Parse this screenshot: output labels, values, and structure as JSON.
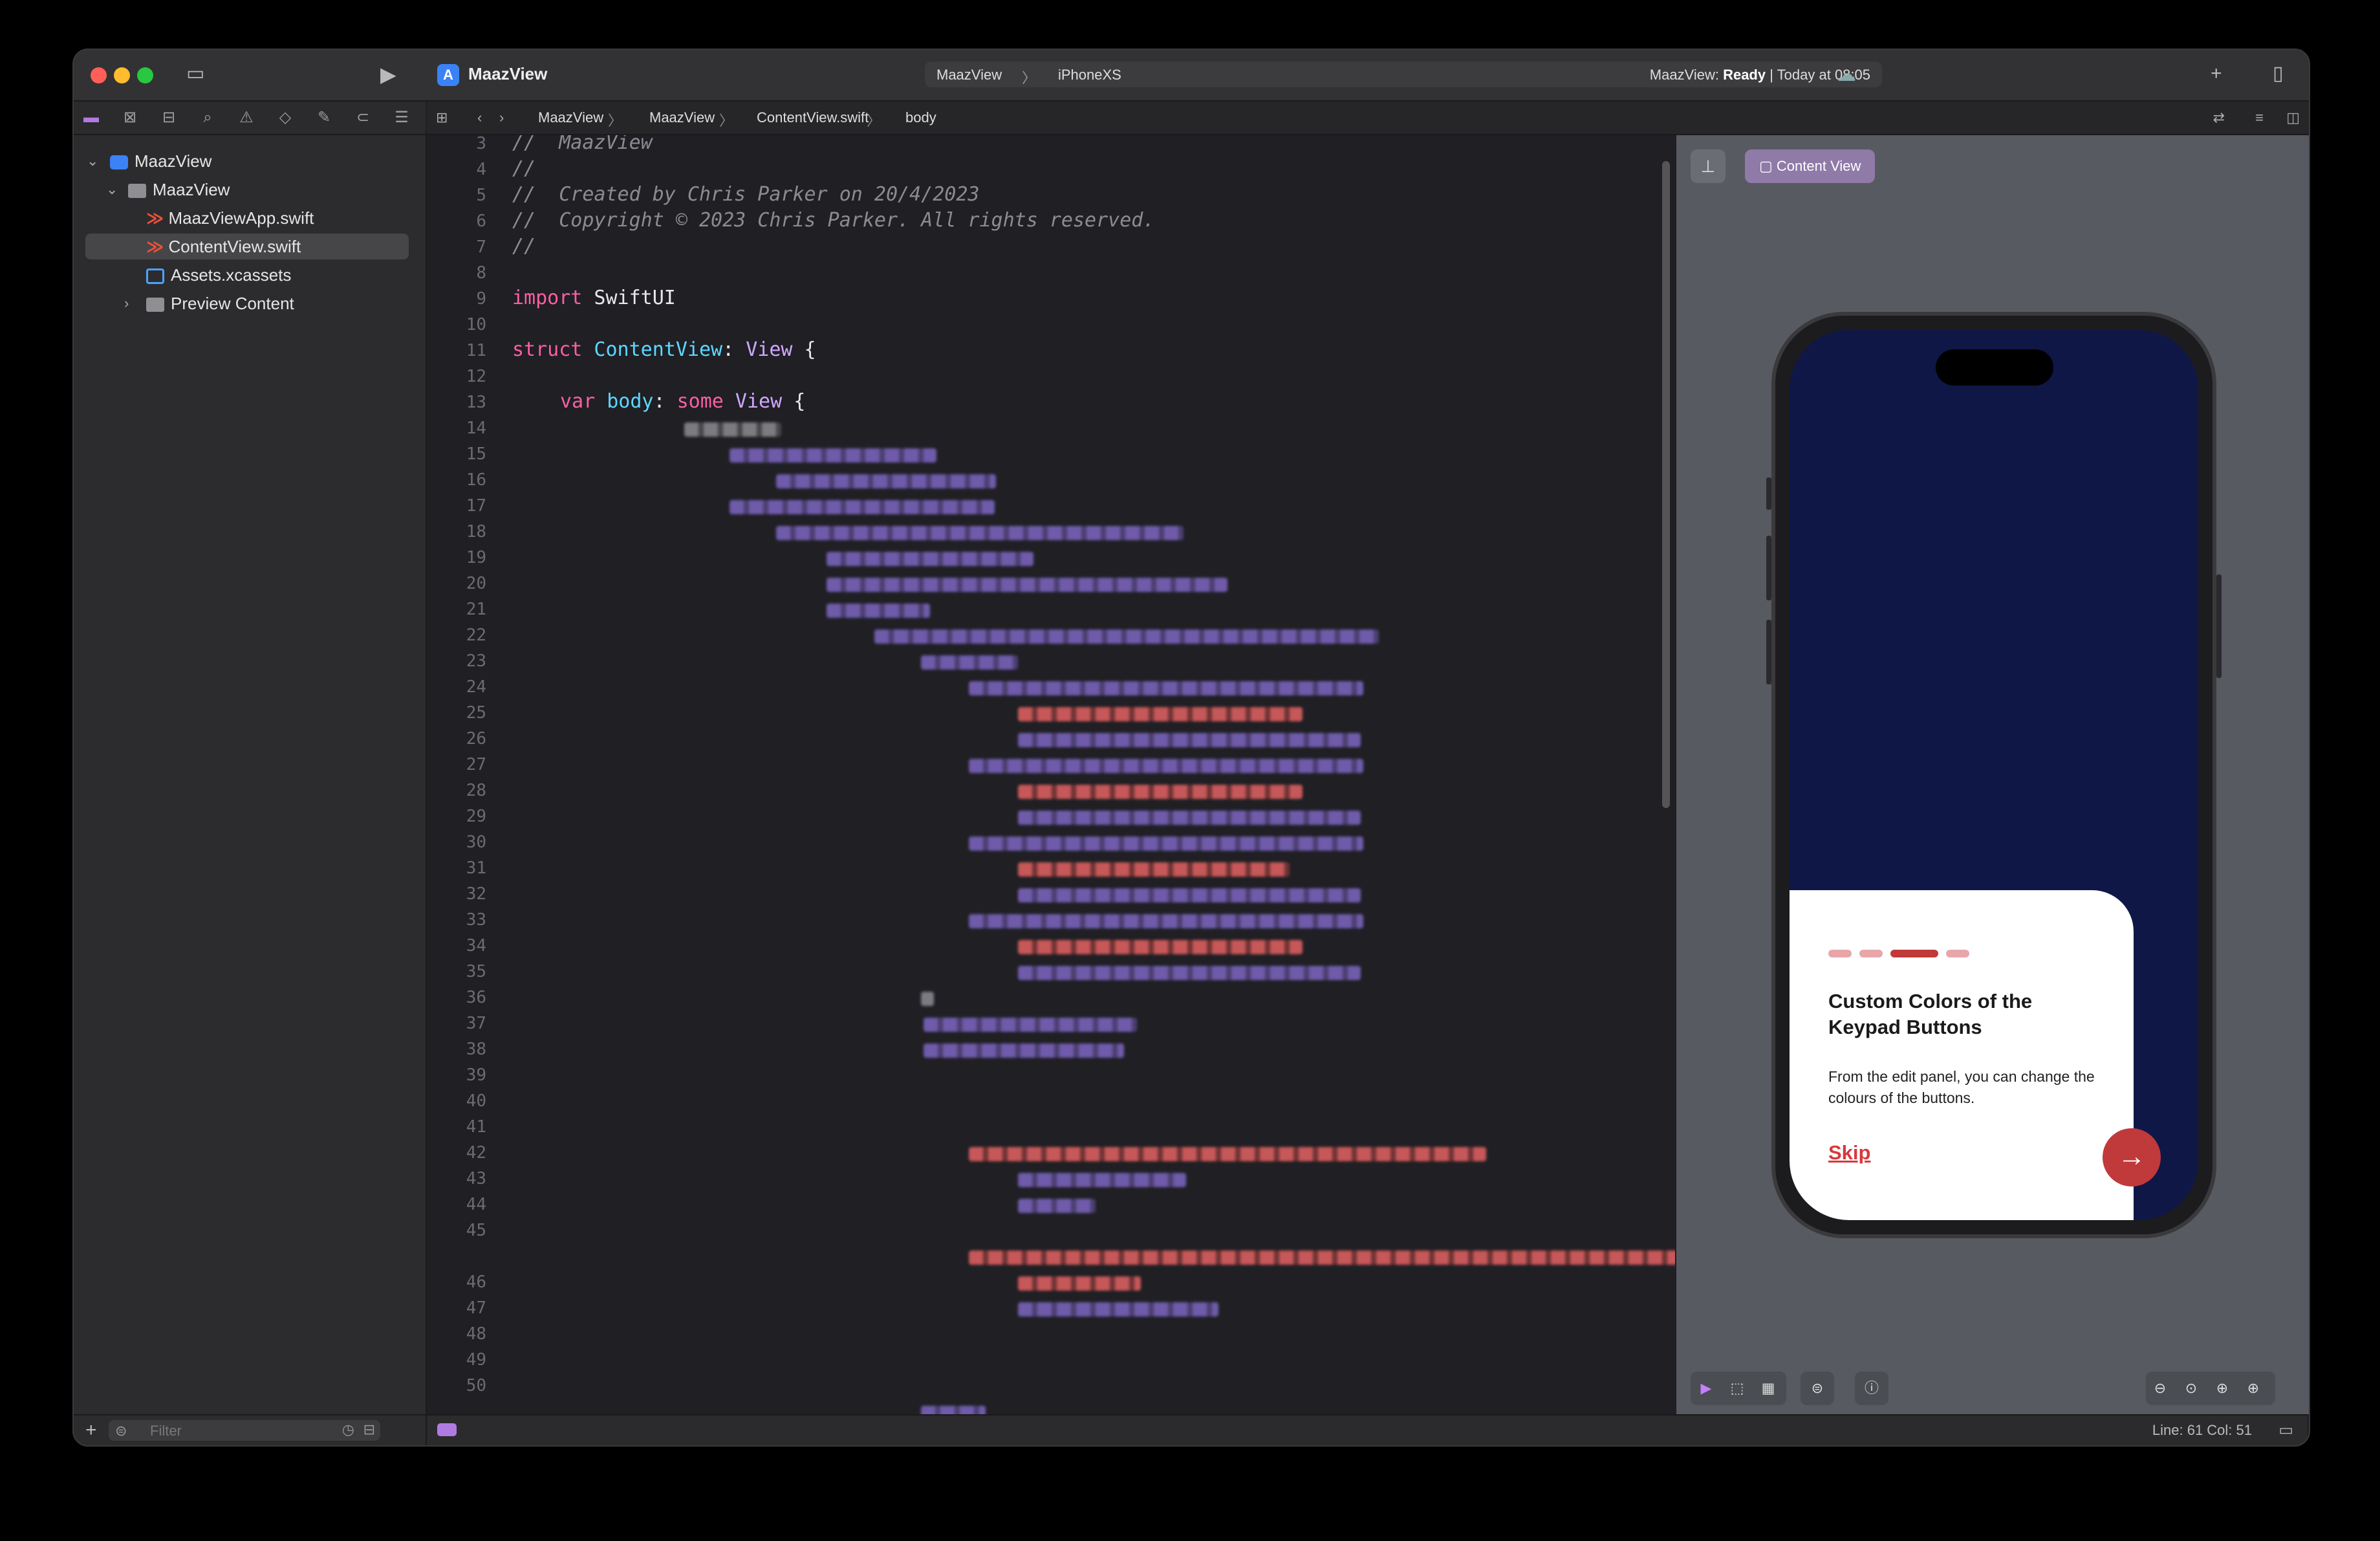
{
  "window": {
    "project_title": "MaazView",
    "scheme": {
      "target": "MaazView",
      "device": "iPhoneXS"
    },
    "status": {
      "prefix": "MaazView: ",
      "state": "Ready",
      "suffix": " | Today at 08:05"
    }
  },
  "jumpbar": {
    "items": [
      "MaazView",
      "MaazView",
      "ContentView.swift",
      "body"
    ]
  },
  "navigator": {
    "tree": [
      {
        "label": "MaazView",
        "type": "project",
        "level": 0,
        "expanded": true
      },
      {
        "label": "MaazView",
        "type": "folder",
        "level": 1,
        "expanded": true
      },
      {
        "label": "MaazViewApp.swift",
        "type": "swift",
        "level": 2
      },
      {
        "label": "ContentView.swift",
        "type": "swift",
        "level": 2,
        "selected": true
      },
      {
        "label": "Assets.xcassets",
        "type": "assets",
        "level": 2
      },
      {
        "label": "Preview Content",
        "type": "folder",
        "level": 2,
        "expanded": false
      }
    ],
    "filter_placeholder": "Filter"
  },
  "editor": {
    "line_numbers": [
      "3",
      "4",
      "5",
      "6",
      "7",
      "8",
      "9",
      "10",
      "11",
      "12",
      "13",
      "14",
      "15",
      "16",
      "17",
      "18",
      "19",
      "20",
      "21",
      "22",
      "23",
      "24",
      "25",
      "26",
      "27",
      "28",
      "29",
      "30",
      "31",
      "32",
      "33",
      "34",
      "35",
      "36",
      "37",
      "38",
      "39",
      "40",
      "41",
      "42",
      "43",
      "44",
      "45",
      "46",
      "47",
      "48",
      "49",
      "50"
    ],
    "visible_code": {
      "l3": "//  MaazView",
      "l4": "//",
      "l5": "//  Created by Chris Parker on 20/4/2023",
      "l6": "//  Copyright © 2023 Chris Parker. All rights reserved.",
      "l7": "//",
      "l9_kw": "import",
      "l9_rest": " SwiftUI",
      "l11_kw": "struct",
      "l11_name": " ContentView",
      "l11_rest": ": ",
      "l11_type": "View",
      "l11_end": " {",
      "l13_kw": "var",
      "l13_name": " body",
      "l13_rest": ": ",
      "l13_kw2": "some",
      "l13_type": " View",
      "l13_end": " {"
    },
    "cursor": "Line: 61  Col: 51"
  },
  "canvas": {
    "chip_label": "Content View",
    "preview": {
      "title": "Custom Colors of the Keypad Buttons",
      "body": "From the edit panel, you can change the colours of the buttons.",
      "skip": "Skip",
      "page_count": 4,
      "active_page": 3
    }
  },
  "colors": {
    "accent": "#c0393b",
    "screen_bg": "#0f1747",
    "keyword": "#fc5fa3",
    "type": "#d0a8ff"
  }
}
